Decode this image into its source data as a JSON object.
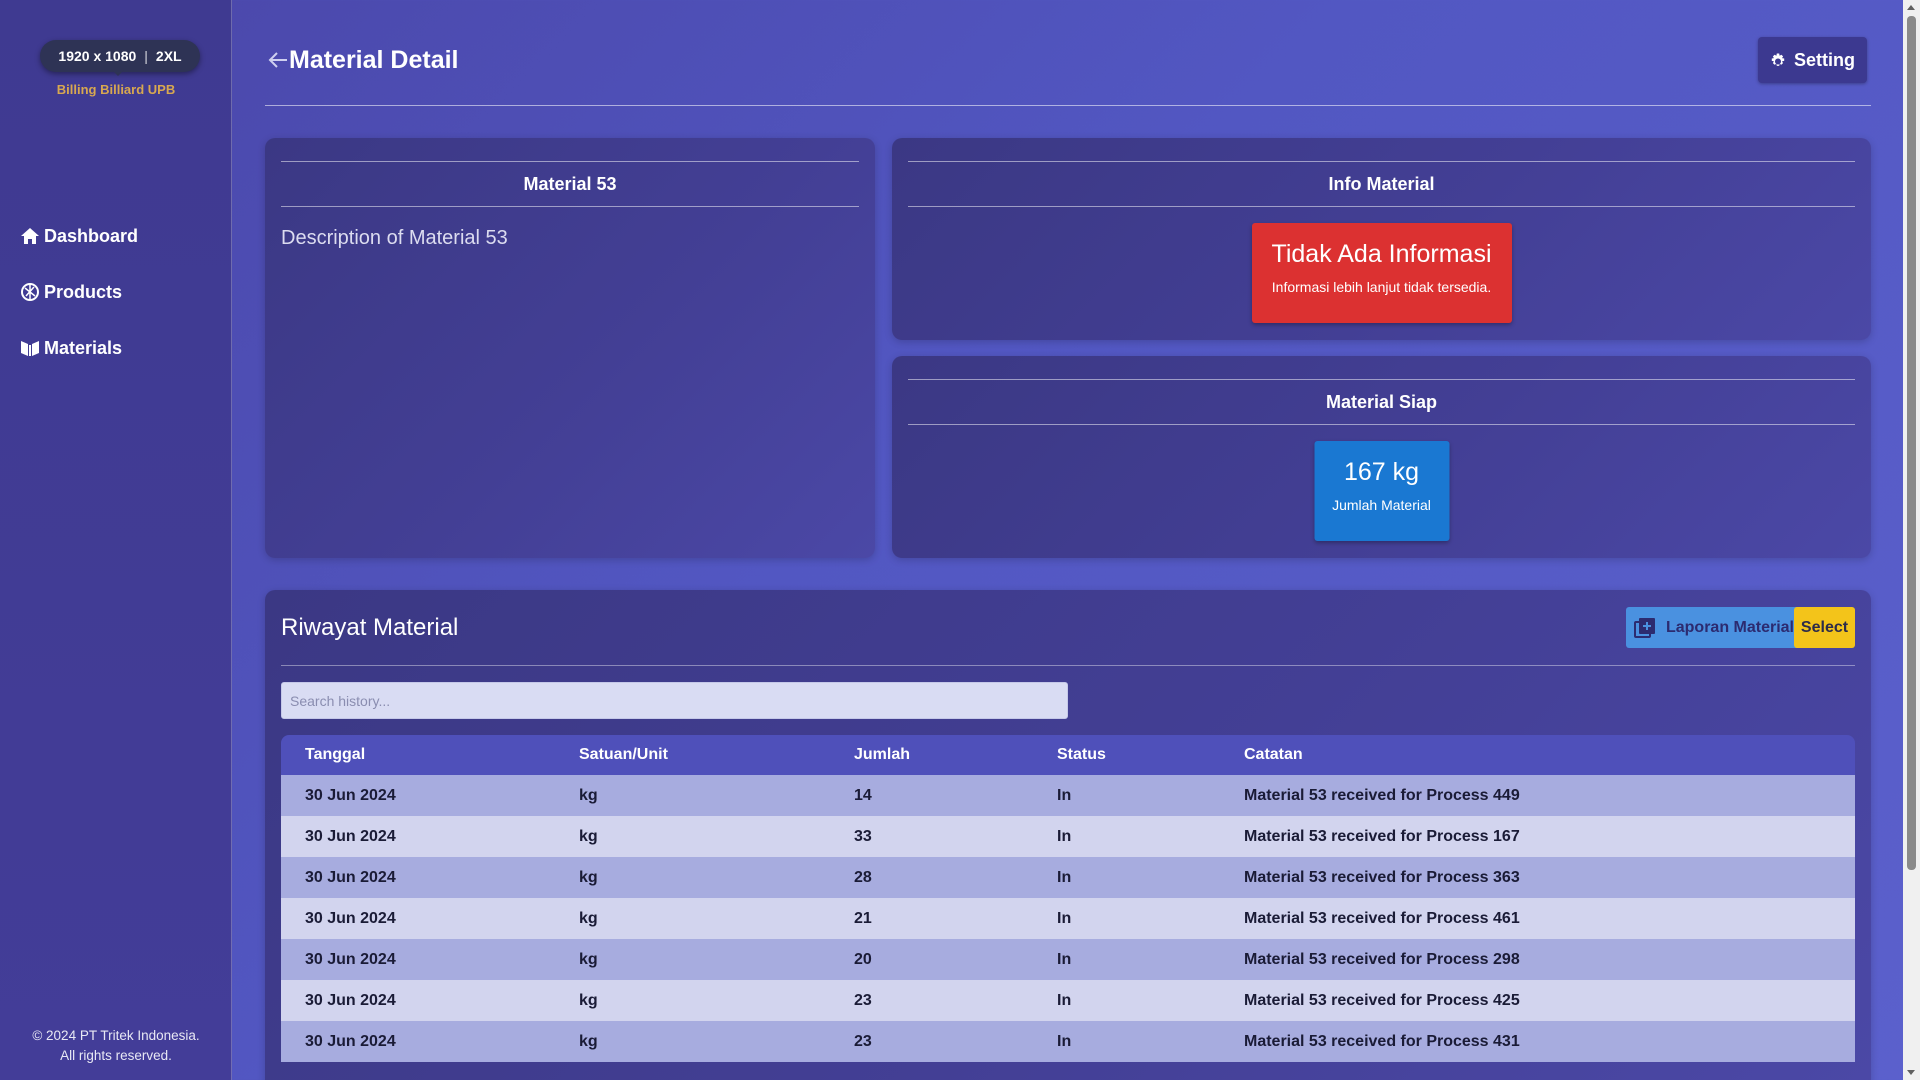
{
  "breakpoint": {
    "size": "1920 x 1080",
    "label": "2XL"
  },
  "brand": "Billing Billiard UPB",
  "sidebar": {
    "items": [
      {
        "label": "Dashboard",
        "icon": "home-icon"
      },
      {
        "label": "Products",
        "icon": "products-icon"
      },
      {
        "label": "Materials",
        "icon": "materials-icon"
      }
    ],
    "footer_line1": "© 2024 PT Tritek Indonesia.",
    "footer_line2": "All rights reserved."
  },
  "header": {
    "title": "Material Detail",
    "setting_label": "Setting"
  },
  "material_card": {
    "title": "Material 53",
    "description": "Description of Material 53"
  },
  "info_card": {
    "title": "Info Material",
    "alert_title": "Tidak Ada Informasi",
    "alert_text": "Informasi lebih lanjut tidak tersedia.",
    "alert_color": "#dc3131"
  },
  "stock_card": {
    "title": "Material Siap",
    "value": "167 kg",
    "label": "Jumlah Material",
    "color": "#1a78d2"
  },
  "history": {
    "title": "Riwayat Material",
    "report_button": "Laporan Material",
    "select_button": "Select",
    "search_placeholder": "Search history...",
    "columns": [
      "Tanggal",
      "Satuan/Unit",
      "Jumlah",
      "Status",
      "Catatan"
    ],
    "rows": [
      [
        "30 Jun 2024",
        "kg",
        "14",
        "In",
        "Material 53 received for Process 449"
      ],
      [
        "30 Jun 2024",
        "kg",
        "33",
        "In",
        "Material 53 received for Process 167"
      ],
      [
        "30 Jun 2024",
        "kg",
        "28",
        "In",
        "Material 53 received for Process 363"
      ],
      [
        "30 Jun 2024",
        "kg",
        "21",
        "In",
        "Material 53 received for Process 461"
      ],
      [
        "30 Jun 2024",
        "kg",
        "20",
        "In",
        "Material 53 received for Process 298"
      ],
      [
        "30 Jun 2024",
        "kg",
        "23",
        "In",
        "Material 53 received for Process 425"
      ],
      [
        "30 Jun 2024",
        "kg",
        "23",
        "In",
        "Material 53 received for Process 431"
      ]
    ]
  }
}
